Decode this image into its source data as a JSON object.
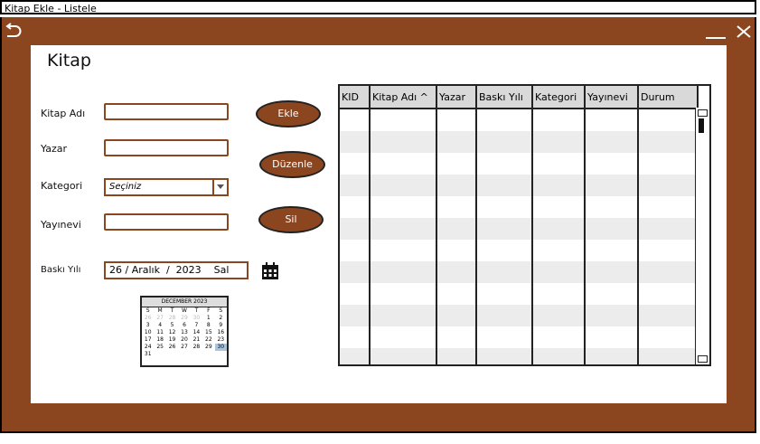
{
  "window": {
    "title": "Kitap Ekle - Listele"
  },
  "form": {
    "heading": "Kitap",
    "fields": {
      "kitap_adi_label": "Kitap Adı",
      "yazar_label": "Yazar",
      "kategori_label": "Kategori",
      "kategori_value": "Seçiniz",
      "yayinevi_label": "Yayınevi",
      "baski_yili_label": "Baskı Yılı",
      "baski_yili_value": "26 / Aralık  /  2023    Sal"
    },
    "buttons": {
      "ekle": "Ekle",
      "duzenle": "Düzenle",
      "sil": "Sil"
    }
  },
  "calendar": {
    "title": "DECEMBER 2023",
    "weekdays": [
      "S",
      "M",
      "T",
      "W",
      "T",
      "F",
      "S"
    ],
    "weeks": [
      [
        "26",
        "27",
        "28",
        "29",
        "30",
        "1",
        "2"
      ],
      [
        "3",
        "4",
        "5",
        "6",
        "7",
        "8",
        "9"
      ],
      [
        "10",
        "11",
        "12",
        "13",
        "14",
        "15",
        "16"
      ],
      [
        "17",
        "18",
        "19",
        "20",
        "21",
        "22",
        "23"
      ],
      [
        "24",
        "25",
        "26",
        "27",
        "28",
        "29",
        "30"
      ],
      [
        "31",
        "",
        "",
        "",
        "",
        "",
        ""
      ]
    ]
  },
  "table": {
    "columns": [
      "KID",
      "Kitap Adı ^",
      "Yazar",
      "Baskı Yılı",
      "Kategori",
      "Yayınevi",
      "Durum"
    ],
    "rows": []
  },
  "colors": {
    "frame": "#8b4620",
    "button": "#8b4620",
    "header": "#d9d9d9"
  },
  "icons": {
    "undo": "undo-icon",
    "minimize": "minimize-icon",
    "close": "close-icon",
    "calendar": "calendar-icon"
  }
}
